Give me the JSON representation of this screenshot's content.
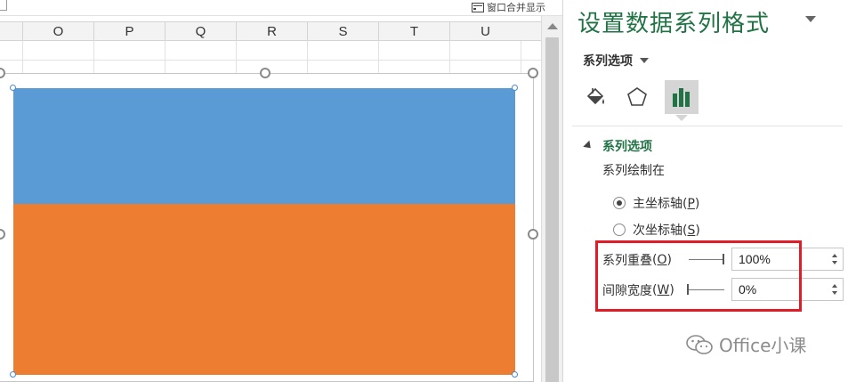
{
  "toolbar": {
    "window_merge_label": "窗口合并显示"
  },
  "sheet": {
    "columns": [
      "O",
      "P",
      "Q",
      "R",
      "S",
      "T",
      "U"
    ]
  },
  "chart": {
    "series_colors": {
      "top": "#5b9bd5",
      "bottom": "#ed7d31"
    }
  },
  "pane": {
    "title": "设置数据系列格式",
    "options_dropdown": "系列选项",
    "tabs": [
      {
        "name": "fill-line",
        "icon": "paint-bucket-icon"
      },
      {
        "name": "effects",
        "icon": "pentagon-icon"
      },
      {
        "name": "series-options",
        "icon": "bar-chart-icon",
        "active": true
      }
    ],
    "section_title": "系列选项",
    "plot_series_on": "系列绘制在",
    "primary_axis": {
      "label": "主坐标轴",
      "key": "P",
      "selected": true
    },
    "secondary_axis": {
      "label": "次坐标轴",
      "key": "S",
      "selected": false
    },
    "overlap": {
      "label": "系列重叠",
      "key": "O",
      "value": "100%"
    },
    "gap_width": {
      "label": "间隙宽度",
      "key": "W",
      "value": "0%"
    },
    "accent_color": "#217346",
    "highlight_color": "#e21c26"
  },
  "watermark": {
    "text": "Office小课"
  }
}
